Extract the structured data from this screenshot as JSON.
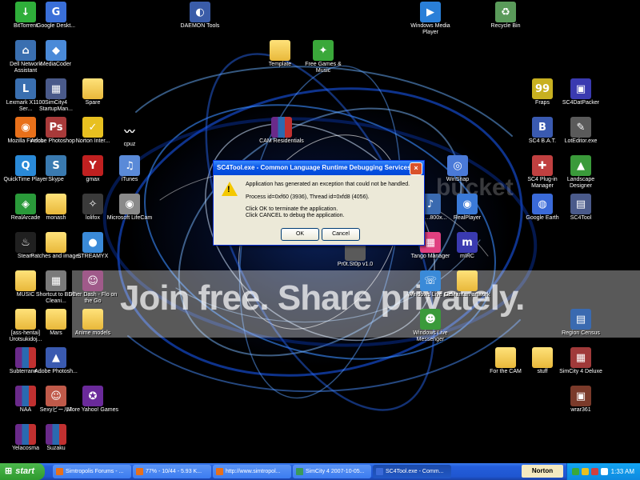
{
  "desktop": {
    "watermark": "Join free. Share privately.",
    "brand_mark": "bucket",
    "icons": [
      {
        "label": "BitTorrent",
        "type": "bittorrent-icon",
        "color": "#2fae3a",
        "glyph": "↓"
      },
      {
        "label": "Google Deskt...",
        "type": "google-desktop-icon",
        "color": "#3a6fd8",
        "glyph": "G"
      },
      {
        "label": "DAEMON Tools",
        "type": "daemon-tools-icon",
        "color": "#3a5ca8",
        "glyph": "◐"
      },
      {
        "label": "Windows Media Player",
        "type": "media-player-icon",
        "color": "#2a7fd8",
        "glyph": "▶"
      },
      {
        "label": "Recycle Bin",
        "type": "recycle-bin-icon",
        "color": "#5a9a5a",
        "glyph": "♻"
      },
      {
        "label": "Dell Network Assistant",
        "type": "dell-network-icon",
        "color": "#3a6fb0",
        "glyph": "⌂"
      },
      {
        "label": "MediaCoder",
        "type": "mediacoder-icon",
        "color": "#4a8ad8",
        "glyph": "◆"
      },
      {
        "label": "Template",
        "type": "folder-icon",
        "color": "#e8b83a",
        "glyph": ""
      },
      {
        "label": "Free Games & Music",
        "type": "gift-icon",
        "color": "#3aa83a",
        "glyph": "✦"
      },
      {
        "label": "Lexmark X1100 Ser...",
        "type": "lexmark-icon",
        "color": "#3a6fb0",
        "glyph": "L"
      },
      {
        "label": "SimCity4 StartupMan...",
        "type": "simcity-icon",
        "color": "#4a5a8a",
        "glyph": "▦"
      },
      {
        "label": "Spare",
        "type": "folder-icon",
        "color": "#e8b83a",
        "glyph": ""
      },
      {
        "label": "Fraps",
        "type": "fraps-icon",
        "color": "#c8b020",
        "glyph": "99"
      },
      {
        "label": "SC4DatPacker",
        "type": "sc4datpacker-icon",
        "color": "#3a3ab0",
        "glyph": "▣"
      },
      {
        "label": "Mozilla Firefox",
        "type": "firefox-icon",
        "color": "#e8701a",
        "glyph": "◉"
      },
      {
        "label": "Adobe Photoshop ...",
        "type": "photoshop-icon",
        "color": "#a83a3a",
        "glyph": "Ps"
      },
      {
        "label": "Norton Inter...",
        "type": "norton-icon",
        "color": "#e8c020",
        "glyph": "✓"
      },
      {
        "label": "cpuz",
        "type": "cpuz-icon",
        "color": "#000000",
        "glyph": "〰"
      },
      {
        "label": "CAM Residentials",
        "type": "winrar-icon",
        "color": "#6a2a8a",
        "glyph": ""
      },
      {
        "label": "SC4 B.A.T.",
        "type": "sc4bat-icon",
        "color": "#3a5ab0",
        "glyph": "B"
      },
      {
        "label": "LotEditor.exe",
        "type": "loteditor-icon",
        "color": "#5a5a5a",
        "glyph": "✎"
      },
      {
        "label": "QuickTime Player",
        "type": "quicktime-icon",
        "color": "#2a8ad8",
        "glyph": "Q"
      },
      {
        "label": "Skype",
        "type": "skype-icon",
        "color": "#3a7ab0",
        "glyph": "S"
      },
      {
        "label": "gmax",
        "type": "gmax-icon",
        "color": "#c02020",
        "glyph": "Y"
      },
      {
        "label": "iTunes",
        "type": "itunes-icon",
        "color": "#5a8ad8",
        "glyph": "♫"
      },
      {
        "label": "WinSnap",
        "type": "winsnap-icon",
        "color": "#4a7ad8",
        "glyph": "◎"
      },
      {
        "label": "SC4 Plug-in Manager",
        "type": "plugin-manager-icon",
        "color": "#c04040",
        "glyph": "✚"
      },
      {
        "label": "Landscape Designer",
        "type": "landscape-icon",
        "color": "#3a9a3a",
        "glyph": "▲"
      },
      {
        "label": "RealArcade",
        "type": "realarcade-icon",
        "color": "#2a9a3a",
        "glyph": "◈"
      },
      {
        "label": "monash",
        "type": "folder-icon",
        "color": "#e8b83a",
        "glyph": ""
      },
      {
        "label": "lolifox",
        "type": "lolifox-icon",
        "color": "#3a3a3a",
        "glyph": "✧"
      },
      {
        "label": "Microsoft LifeCam",
        "type": "lifecam-icon",
        "color": "#8a8a8a",
        "glyph": "◉"
      },
      {
        "label": "The ...800x...",
        "type": "the-icon",
        "color": "#3a6ab0",
        "glyph": "♪"
      },
      {
        "label": "RealPlayer",
        "type": "realplayer-icon",
        "color": "#3a7ad8",
        "glyph": "◉"
      },
      {
        "label": "Google Earth",
        "type": "google-earth-icon",
        "color": "#3a6ad8",
        "glyph": "◍"
      },
      {
        "label": "SC4Tool",
        "type": "sc4tool-icon",
        "color": "#4a5a8a",
        "glyph": "▤"
      },
      {
        "label": "Steam",
        "type": "steam-icon",
        "color": "#202020",
        "glyph": "♨"
      },
      {
        "label": "Patches and images",
        "type": "folder-icon",
        "color": "#e8b83a",
        "glyph": ""
      },
      {
        "label": "STREAMYX",
        "type": "streamyx-icon",
        "color": "#3a8ad8",
        "glyph": "●"
      },
      {
        "label": "Pr0t.St0p v1.0",
        "type": "protstop-icon",
        "color": "#5a5a5a",
        "glyph": ""
      },
      {
        "label": "Tango Manager",
        "type": "tango-icon",
        "color": "#e04080",
        "glyph": "▦"
      },
      {
        "label": "mIRC",
        "type": "mirc-icon",
        "color": "#3a3ab0",
        "glyph": "m"
      },
      {
        "label": "MUSIC",
        "type": "folder-icon",
        "color": "#e8b83a",
        "glyph": ""
      },
      {
        "label": "Shortcut to BSC Cleani...",
        "type": "bsc-cleaner-icon",
        "color": "#7a7a7a",
        "glyph": "▦"
      },
      {
        "label": "Diner Dash - Flo on the Go",
        "type": "diner-dash-icon",
        "color": "#a05a8a",
        "glyph": "☺"
      },
      {
        "label": "Windows Live Call",
        "type": "live-call-icon",
        "color": "#3a8ad8",
        "glyph": "☏"
      },
      {
        "label": "Deviantart artwork",
        "type": "folder-icon",
        "color": "#e8b83a",
        "glyph": ""
      },
      {
        "label": "[ass-hentai] Urotsukidoj...",
        "type": "folder-icon",
        "color": "#e8b83a",
        "glyph": ""
      },
      {
        "label": "Mars",
        "type": "folder-icon",
        "color": "#e8b83a",
        "glyph": ""
      },
      {
        "label": "Anime models",
        "type": "folder-icon",
        "color": "#e8b83a",
        "glyph": ""
      },
      {
        "label": "Windows Live Messenger",
        "type": "messenger-icon",
        "color": "#3a9a3a",
        "glyph": "☻"
      },
      {
        "label": "Region Census",
        "type": "region-census-icon",
        "color": "#3a6ab0",
        "glyph": "▤"
      },
      {
        "label": "Subterrane...",
        "type": "winrar-icon",
        "color": "#6a2a8a",
        "glyph": ""
      },
      {
        "label": "Adobe Photosh...",
        "type": "photoshop-icon",
        "color": "#3a5ab0",
        "glyph": "▲"
      },
      {
        "label": "For the CAM",
        "type": "folder-icon",
        "color": "#e8b83a",
        "glyph": ""
      },
      {
        "label": "stuff",
        "type": "folder-icon",
        "color": "#e8b83a",
        "glyph": ""
      },
      {
        "label": "SimCity 4 Deluxe",
        "type": "simcity-deluxe-icon",
        "color": "#a03a3a",
        "glyph": "▦"
      },
      {
        "label": "NAA",
        "type": "winrar-icon",
        "color": "#6a2a8a",
        "glyph": ""
      },
      {
        "label": "Sexyビール2",
        "type": "sexy-icon",
        "color": "#c05a4a",
        "glyph": "☺"
      },
      {
        "label": "More Yahoo! Games",
        "type": "yahoo-games-icon",
        "color": "#6a2a9a",
        "glyph": "✪"
      },
      {
        "label": "wrar361",
        "type": "wrar-icon",
        "color": "#7a3a2a",
        "glyph": "▣"
      },
      {
        "label": "Yelacosma",
        "type": "winrar-icon",
        "color": "#6a2a8a",
        "glyph": ""
      },
      {
        "label": "Suzaku",
        "type": "winrar-icon",
        "color": "#6a2a8a",
        "glyph": ""
      }
    ]
  },
  "dialog": {
    "title": "SC4Tool.exe - Common Language Runtime Debugging Services",
    "line1": "Application has generated an exception that could not be handled.",
    "line2": "Process id=0xf60 (3936), Thread id=0xfd8 (4056).",
    "line3": "Click OK to terminate the application.",
    "line4": "Click CANCEL to debug the application.",
    "ok_label": "OK",
    "cancel_label": "Cancel",
    "close_glyph": "×"
  },
  "taskbar": {
    "start_label": "start",
    "tasks": [
      {
        "label": "Simtropolis Forums - ...",
        "icon_color": "#e8701a"
      },
      {
        "label": "77% - 10/44 - 5.93 K...",
        "icon_color": "#e8701a"
      },
      {
        "label": "http://www.simtropol...",
        "icon_color": "#e8701a"
      },
      {
        "label": "SimCity 4 2007-10-05...",
        "icon_color": "#3a9a5a"
      },
      {
        "label": "SC4Tool.exe - Comm...",
        "icon_color": "#3a6ad8"
      }
    ],
    "norton_label": "Norton",
    "clock": "1:33 AM"
  }
}
